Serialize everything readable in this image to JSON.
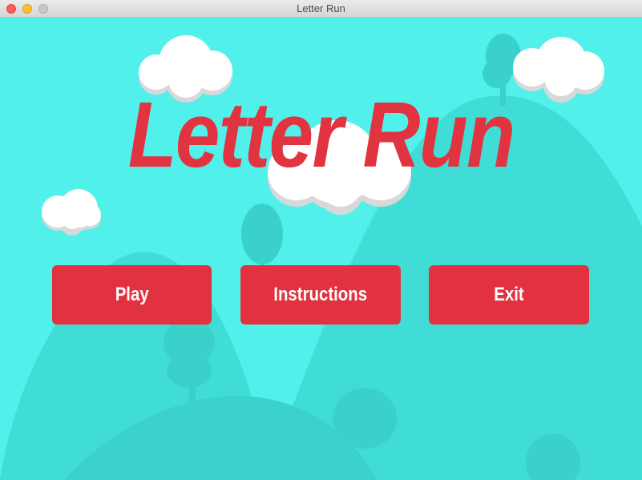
{
  "window": {
    "title": "Letter Run"
  },
  "game": {
    "title": "Letter Run"
  },
  "menu": {
    "play_label": "Play",
    "instructions_label": "Instructions",
    "exit_label": "Exit"
  },
  "colors": {
    "sky": "#52f0eb",
    "hill": "#40dcd6",
    "accent_red": "#e2323f",
    "cloud": "#ffffff"
  }
}
